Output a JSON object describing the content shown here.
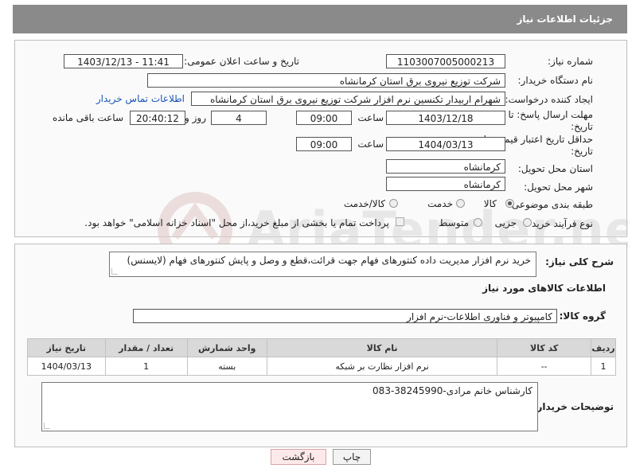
{
  "header": {
    "title": "جزئیات اطلاعات نیاز"
  },
  "fields": {
    "need_number_label": "شماره نیاز:",
    "need_number": "1103007005000213",
    "announce_label": "تاریخ و ساعت اعلان عمومی:",
    "announce_value": "1403/12/13 - 11:41",
    "buyer_org_label": "نام دستگاه خریدار:",
    "buyer_org": "شرکت توزیع نیروی برق استان کرمانشاه",
    "creator_label": "ایجاد کننده درخواست:",
    "creator": "شهرام اربیدار تکنسین نرم افزار شرکت توزیع نیروی برق استان کرمانشاه",
    "contact_link": "اطلاعات تماس خریدار",
    "deadline_label_1": "مهلت ارسال پاسخ: تا",
    "deadline_label_2": "تاریخ:",
    "deadline_date": "1403/12/18",
    "time_label": "ساعت",
    "deadline_time": "09:00",
    "days_value": "4",
    "days_label": "روز و",
    "remaining_time": "20:40:12",
    "remaining_label": "ساعت باقی مانده",
    "price_label_1": "حداقل تاریخ اعتبار قیمت: تا",
    "price_label_2": "تاریخ:",
    "price_date": "1404/03/13",
    "price_time": "09:00",
    "province_label": "استان محل تحویل:",
    "province": "کرمانشاه",
    "city_label": "شهر محل تحویل:",
    "city": "کرمانشاه",
    "category_label": "طبقه بندی موضوعی:",
    "category_options": [
      "کالا",
      "خدمت",
      "کالا/خدمت"
    ],
    "category_selected": "کالا",
    "process_label": "نوع فرآیند خرید :",
    "process_options": [
      "جزیی",
      "متوسط"
    ],
    "payment_note": "پرداخت تمام یا بخشی از مبلغ خرید،از محل \"اسناد خزانه اسلامی\" خواهد بود."
  },
  "description": {
    "label": "شرح کلی نیاز:",
    "text": "خرید نرم افزار مدیریت داده کنتورهای فهام جهت قرائت،قطع و وصل و پایش کنتورهای فهام (لایسنس)"
  },
  "goods": {
    "section_title": "اطلاعات کالاهای مورد نیاز",
    "group_label": "گروه کالا:",
    "group_value": "کامپیوتر و فناوری اطلاعات-نرم افزار",
    "columns": [
      "ردیف",
      "کد کالا",
      "نام کالا",
      "واحد شمارش",
      "تعداد / مقدار",
      "تاریخ نیاز"
    ],
    "rows": [
      [
        "1",
        "--",
        "نرم افزار نظارت بر شبکه",
        "بسته",
        "1",
        "1404/03/13"
      ]
    ]
  },
  "buyer_notes": {
    "label": "توضیحات خریدار:",
    "text": "کارشناس خانم مرادی-38245990-083"
  },
  "buttons": {
    "print": "چاپ",
    "return": "بازگشت"
  },
  "watermark": "AriaTender.neT"
}
